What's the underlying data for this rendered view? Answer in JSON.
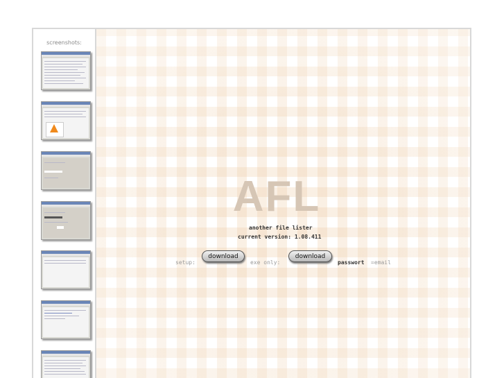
{
  "sidebar": {
    "title": "screenshots:",
    "thumbnails": [
      {
        "label": "screenshot 1"
      },
      {
        "label": "screenshot 2"
      },
      {
        "label": "screenshot 3"
      },
      {
        "label": "screenshot 4"
      },
      {
        "label": "screenshot 5"
      },
      {
        "label": "screenshot 6"
      },
      {
        "label": "screenshot 7"
      }
    ]
  },
  "main": {
    "logo": "AFL",
    "subtitle": "another file lister",
    "version": "current version: 1.08.411",
    "setup_label": "setup:",
    "exe_label": "exe only:",
    "download_label": "download",
    "password_label": "passwort",
    "password_hint": "=email"
  },
  "colors": {
    "logo": "#d6c6b5",
    "checker": "#ecc8a0",
    "border": "#d8d8d8"
  }
}
